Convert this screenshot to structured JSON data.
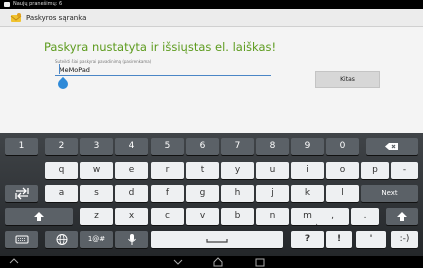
{
  "status_bar": {
    "notification_text": "Naujų pranešimų: 6"
  },
  "action_bar": {
    "title": "Paskyros sąranka"
  },
  "content": {
    "headline": "Paskyra nustatyta ir išsiųstas el. laiškas!",
    "field_hint": "Suteikti šiai paskyrai pavadinimą (pasirenkama)",
    "field_value": "MeMoPad",
    "next_button": "Kitas"
  },
  "keyboard": {
    "row_numbers": [
      "1",
      "2",
      "3",
      "4",
      "5",
      "6",
      "7",
      "8",
      "9",
      "0"
    ],
    "row_q": [
      "q",
      "w",
      "e",
      "r",
      "t",
      "y",
      "u",
      "i",
      "o",
      "p",
      "-"
    ],
    "row_a": [
      "a",
      "s",
      "d",
      "f",
      "g",
      "h",
      "j",
      "k",
      "l"
    ],
    "next_key": "Next",
    "row_z": [
      "z",
      "x",
      "c",
      "v",
      "b",
      "n",
      "m",
      ",",
      "."
    ],
    "bottom_row": {
      "symbols": "1@#",
      "question": "?",
      "exclaim": "!",
      "apostrophe": "'",
      "emoticon": ":-)"
    }
  },
  "icons": [
    "mail-icon",
    "app-account-icon",
    "backspace-icon",
    "tab-icon",
    "shift-icon",
    "keyboard-settings-icon",
    "globe-icon",
    "mic-icon",
    "space-icon",
    "back-nav-icon",
    "hide-keyboard-icon",
    "home-nav-icon",
    "recents-nav-icon"
  ],
  "colors": {
    "accent_green": "#5d9b1e",
    "accent_blue": "#2f8ad8"
  }
}
